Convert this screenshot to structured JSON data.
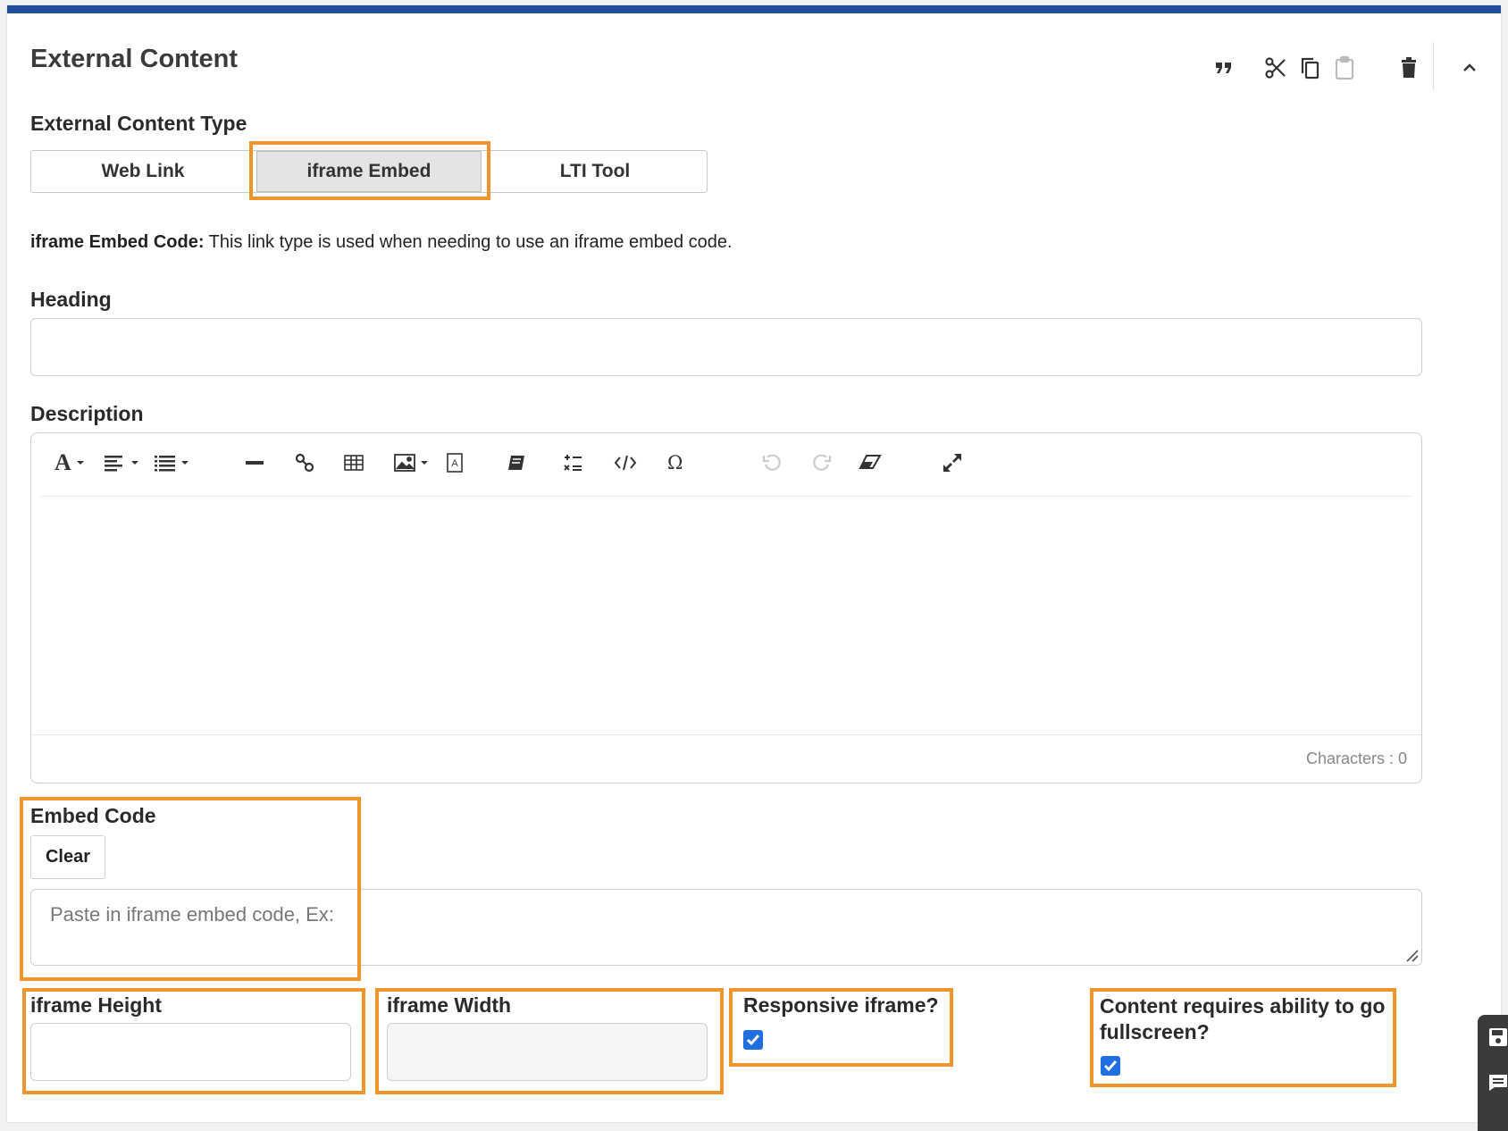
{
  "panel": {
    "title": "External Content",
    "toolbar": [
      "quote-icon",
      "scissors-icon",
      "copy-icon",
      "paste-icon",
      "trash-icon",
      "chevron-up-icon"
    ]
  },
  "content_type": {
    "label": "External Content Type",
    "options": [
      "Web Link",
      "iframe Embed",
      "LTI Tool"
    ],
    "selected": "iframe Embed"
  },
  "type_description": {
    "bold": "iframe Embed Code:",
    "text": " This link type is used when needing to use an iframe embed code."
  },
  "heading": {
    "label": "Heading",
    "value": ""
  },
  "description": {
    "label": "Description",
    "toolbar": [
      "font-icon",
      "align-icon",
      "list-icon",
      "horizontal-rule-icon",
      "link-icon",
      "table-icon",
      "image-icon",
      "text-box-icon",
      "book-icon",
      "math-icon",
      "code-icon",
      "omega-icon",
      "undo-icon",
      "redo-icon",
      "eraser-icon",
      "expand-icon"
    ],
    "char_count": "Characters : 0"
  },
  "embed_code": {
    "label": "Embed Code",
    "clear_label": "Clear",
    "placeholder": "Paste in iframe embed code, Ex:"
  },
  "iframe_height": {
    "label": "iframe Height",
    "value": ""
  },
  "iframe_width": {
    "label": "iframe Width",
    "value": ""
  },
  "responsive": {
    "label": "Responsive iframe?",
    "checked": true
  },
  "fullscreen": {
    "label": "Content requires ability to go fullscreen?",
    "checked": true
  },
  "colors": {
    "accent": "#1f4f9c",
    "highlight": "#f0942d",
    "checkbox": "#1f6fe0"
  }
}
